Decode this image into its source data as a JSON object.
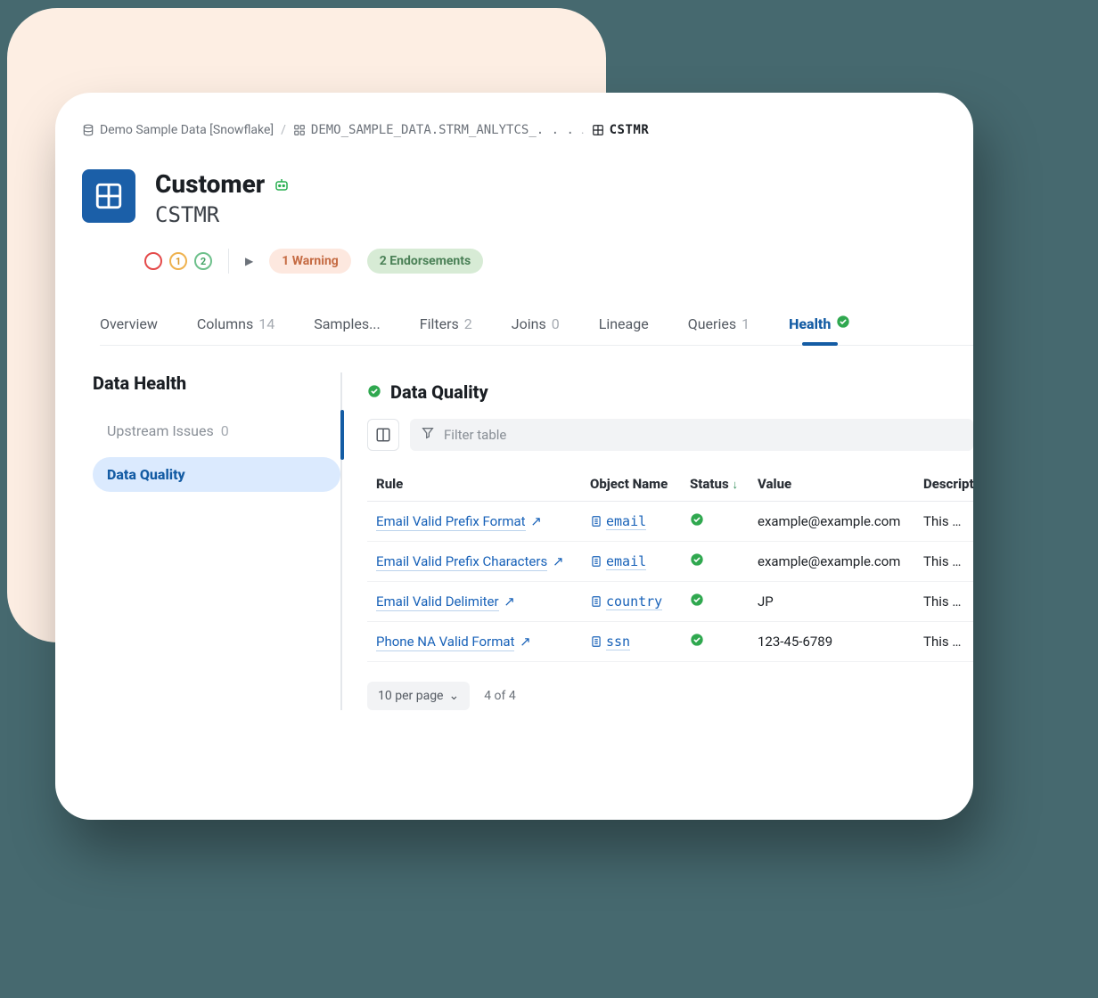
{
  "breadcrumbs": {
    "root": "Demo Sample Data [Snowflake]",
    "schema": "DEMO_SAMPLE_DATA.STRM_ANLYTCS_. . .",
    "object": "CSTMR"
  },
  "header": {
    "title": "Customer",
    "code": "CSTMR"
  },
  "badges": {
    "red_count": "",
    "amber_count": "1",
    "green_count": "2",
    "warning_label": "1 Warning",
    "endorse_label": "2 Endorsements"
  },
  "tabs": [
    {
      "label": "Overview",
      "count": ""
    },
    {
      "label": "Columns",
      "count": "14"
    },
    {
      "label": "Samples...",
      "count": ""
    },
    {
      "label": "Filters",
      "count": "2"
    },
    {
      "label": "Joins",
      "count": "0"
    },
    {
      "label": "Lineage",
      "count": ""
    },
    {
      "label": "Queries",
      "count": "1"
    },
    {
      "label": "Health",
      "count": "",
      "active": true,
      "check": true
    }
  ],
  "sidebar": {
    "heading": "Data Health",
    "items": [
      {
        "label": "Upstream Issues",
        "count": "0"
      },
      {
        "label": "Data Quality",
        "active": true
      }
    ]
  },
  "panel": {
    "title": "Data Quality",
    "filter_placeholder": "Filter table",
    "columns": [
      "Rule",
      "Object Name",
      "Status",
      "Value",
      "Description"
    ],
    "rows": [
      {
        "rule": "Email Valid Prefix Format",
        "object": "email",
        "value": "example@example.com",
        "desc": "This rule c"
      },
      {
        "rule": "Email Valid Prefix Characters",
        "object": "email",
        "value": "example@example.com",
        "desc": "This rule c"
      },
      {
        "rule": "Email Valid Delimiter",
        "object": "country",
        "value": "JP",
        "desc": "This rule c"
      },
      {
        "rule": "Phone NA Valid Format",
        "object": "ssn",
        "value": "123-45-6789",
        "desc": "This rule c"
      }
    ],
    "pager_label": "10 per page",
    "pager_count": "4 of 4"
  }
}
